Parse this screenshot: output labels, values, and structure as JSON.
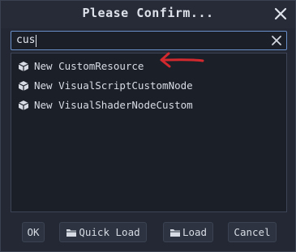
{
  "dialog": {
    "title": "Please Confirm...",
    "search": {
      "value": "cus"
    },
    "results": [
      {
        "label": "New CustomResource",
        "icon": "resource-cube-icon"
      },
      {
        "label": "New VisualScriptCustomNode",
        "icon": "resource-cube-icon"
      },
      {
        "label": "New VisualShaderNodeCustom",
        "icon": "resource-cube-icon"
      }
    ],
    "annotation": {
      "icon": "red-arrow-icon",
      "color": "#d1292e"
    },
    "buttons": {
      "ok": "OK",
      "quick_load": "Quick Load",
      "load": "Load",
      "cancel": "Cancel"
    }
  },
  "colors": {
    "background": "#232834",
    "field": "#1b1f28",
    "focus_border": "#6a90c9"
  }
}
